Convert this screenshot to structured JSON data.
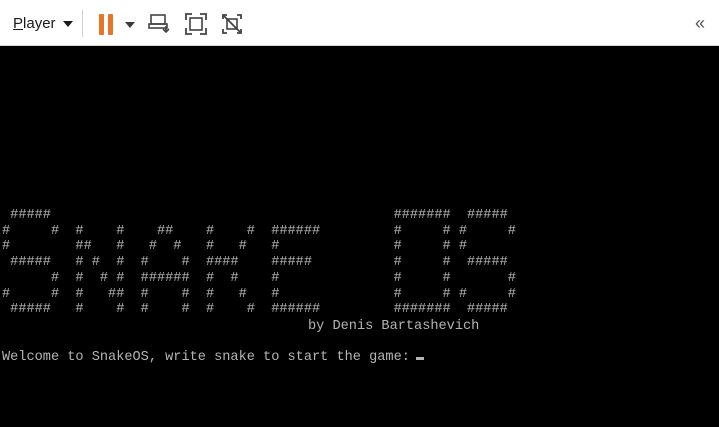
{
  "toolbar": {
    "player_label": "Player",
    "icons": {
      "pause": "pause-icon",
      "send_keys": "send-ctrl-alt-del-icon",
      "fullscreen": "fullscreen-icon",
      "unity": "unity-mode-off-icon",
      "collapse": "double-chevron-left-icon"
    },
    "accent_color": "#e8742a"
  },
  "console": {
    "banner_lines": [
      " #####                                          #######  #####",
      "#     #  #    #    ##    #    #  ######         #     # #     #",
      "#        ##   #   #  #   #   #   #              #     # #",
      " #####   # #  #  #    #  ####    #####          #     #  #####",
      "      #  #  # #  ######  #  #    #              #     #       #",
      "#     #  #   ##  #    #  #   #   #              #     # #     #",
      " #####   #    #  #    #  #    #  ######         #######  #####"
    ],
    "credit": "by Denis Bartashevich",
    "prompt": "Welcome to SnakeOS, write snake to start the game:",
    "text_color": "#b4b4b4",
    "background_color": "#000000"
  }
}
